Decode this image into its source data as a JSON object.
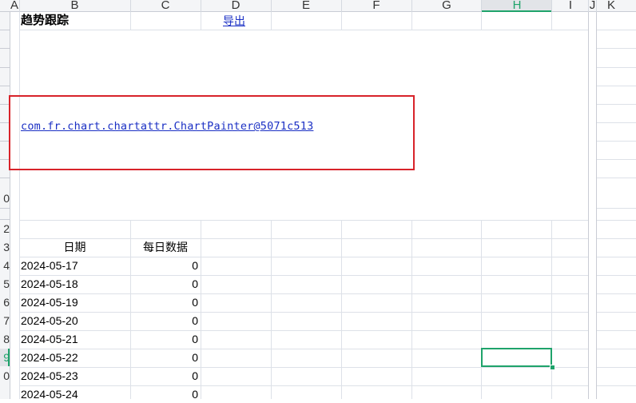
{
  "columns": [
    "A",
    "B",
    "C",
    "D",
    "E",
    "F",
    "G",
    "H",
    "I",
    "J",
    "K"
  ],
  "row_numbers": [
    "",
    "",
    "",
    "",
    "",
    "",
    "",
    "",
    "0",
    "",
    "2",
    "3",
    "4",
    "5",
    "6",
    "7",
    "8",
    "9",
    "0",
    ""
  ],
  "sheet": {
    "title": "趋势跟踪",
    "export_link": "导出",
    "chart_placeholder": "com.fr.chart.chartattr.ChartPainter@5071c513",
    "table": {
      "headers": [
        "日期",
        "每日数据"
      ],
      "rows": [
        [
          "2024-05-17",
          "0"
        ],
        [
          "2024-05-18",
          "0"
        ],
        [
          "2024-05-19",
          "0"
        ],
        [
          "2024-05-20",
          "0"
        ],
        [
          "2024-05-21",
          "0"
        ],
        [
          "2024-05-22",
          "0"
        ],
        [
          "2024-05-23",
          "0"
        ],
        [
          "2024-05-24",
          "0"
        ]
      ]
    }
  },
  "colors": {
    "selection": "#1fa36b",
    "active_header": "#1fa36b",
    "highlight_box": "#d8232a",
    "link": "#1a2fc4"
  }
}
